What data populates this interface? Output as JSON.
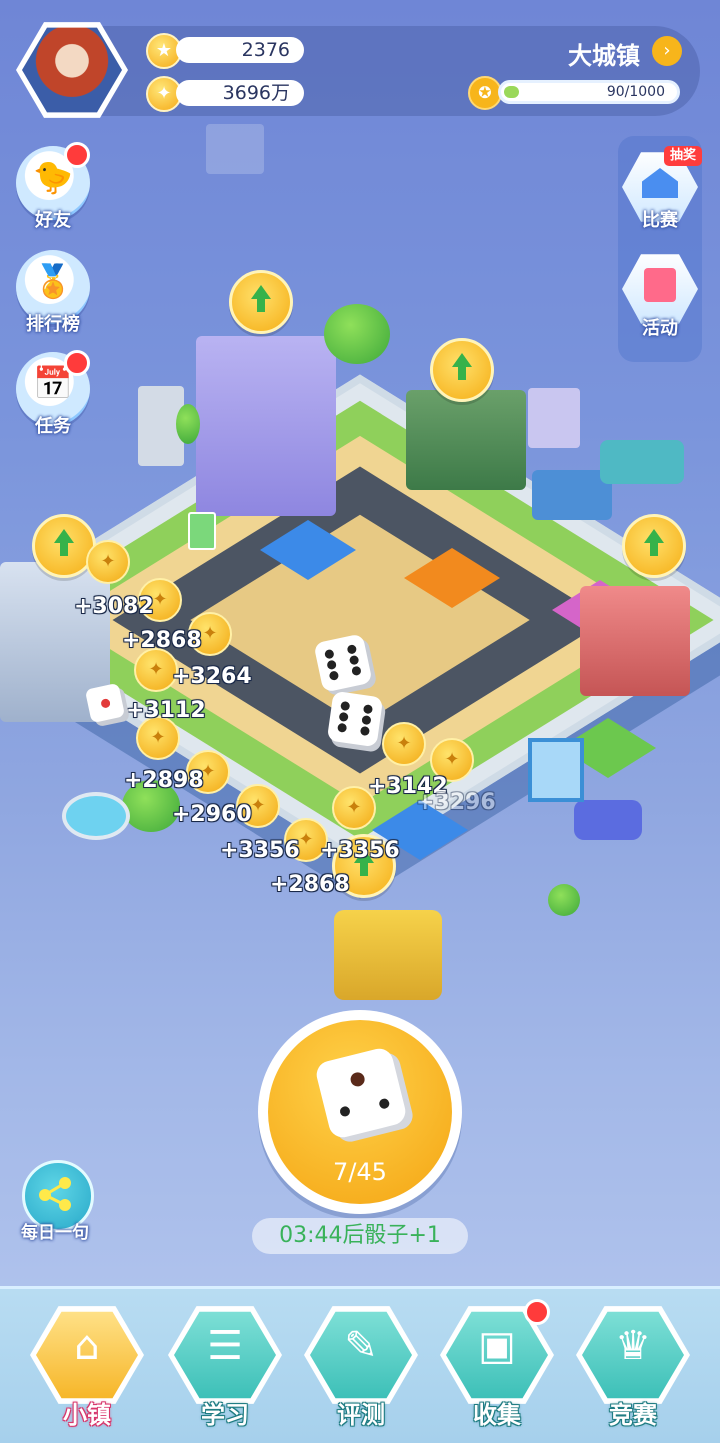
{
  "header": {
    "star_value": "2376",
    "coin_value": "3696万",
    "town_name": "大城镇",
    "level_progress": "90/1000",
    "level_fraction": 0.09
  },
  "left_menu": [
    {
      "label": "好友",
      "icon": "chick-icon",
      "has_dot": true
    },
    {
      "label": "排行榜",
      "icon": "podium-icon",
      "has_dot": false
    },
    {
      "label": "任务",
      "icon": "calendar-check-icon",
      "has_dot": true
    }
  ],
  "right_menu": [
    {
      "label": "比赛",
      "icon": "house-icon",
      "badge": "抽奖"
    },
    {
      "label": "活动",
      "icon": "gift-icon"
    }
  ],
  "board": {
    "rewards": [
      "+3082",
      "+2868",
      "+3264",
      "+3112",
      "+2898",
      "+2960",
      "+3356",
      "+3356",
      "+2868",
      "+3142",
      "+3296"
    ]
  },
  "dice": {
    "count": "7/45",
    "timer": "03:44后骰子+1"
  },
  "share": {
    "label": "每日一句",
    "icon": "share-icon"
  },
  "bottom_nav": [
    {
      "label": "小镇",
      "icon": "house-icon",
      "active": true
    },
    {
      "label": "学习",
      "icon": "books-icon"
    },
    {
      "label": "评测",
      "icon": "checklist-icon"
    },
    {
      "label": "收集",
      "icon": "box-icon",
      "has_dot": true
    },
    {
      "label": "竞赛",
      "icon": "trophy-icon"
    }
  ],
  "colors": {
    "accent_gold": "#f5ad14",
    "nav_teal": "#3bbfb7",
    "alert_red": "#ff3b3b",
    "timer_green": "#39b25a"
  }
}
